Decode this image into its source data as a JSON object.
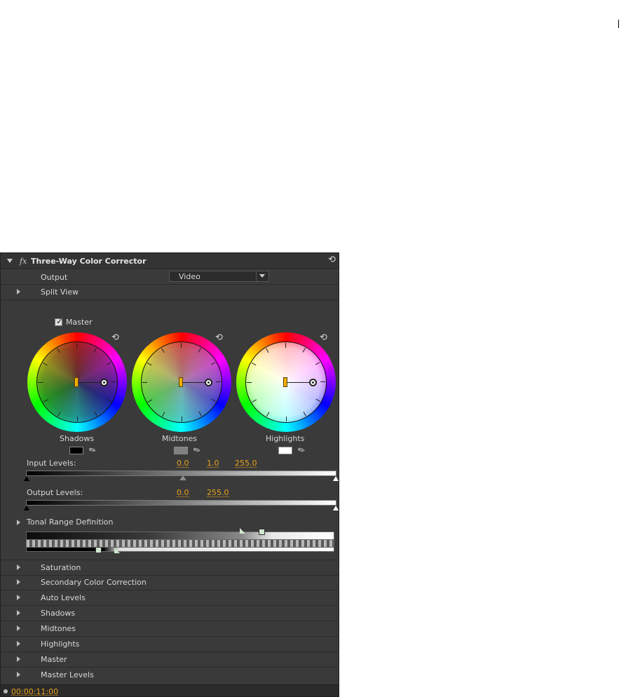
{
  "effect": {
    "name": "Three-Way Color Corrector",
    "fx_label": "fx"
  },
  "output": {
    "label": "Output",
    "value": "Video"
  },
  "split_view": {
    "label": "Split View"
  },
  "master_checkbox": {
    "label": "Master",
    "checked": true
  },
  "wheels": [
    {
      "label": "Shadows",
      "swatch_color": "#000000"
    },
    {
      "label": "Midtones",
      "swatch_color": "#808080"
    },
    {
      "label": "Highlights",
      "swatch_color": "#ffffff"
    }
  ],
  "input_levels": {
    "label": "Input Levels:",
    "black": "0.0",
    "gamma": "1.0",
    "white": "255.0"
  },
  "output_levels": {
    "label": "Output Levels:",
    "black": "0.0",
    "white": "255.0"
  },
  "tonal_range": {
    "label": "Tonal Range Definition"
  },
  "sections": [
    "Saturation",
    "Secondary Color Correction",
    "Auto Levels",
    "Shadows",
    "Midtones",
    "Highlights",
    "Master",
    "Master Levels"
  ],
  "timecode": "00:00:11:00",
  "colors": {
    "panel_bg": "#3a3a3a",
    "accent_orange": "#e9a21b",
    "text": "#d8d8d8"
  }
}
